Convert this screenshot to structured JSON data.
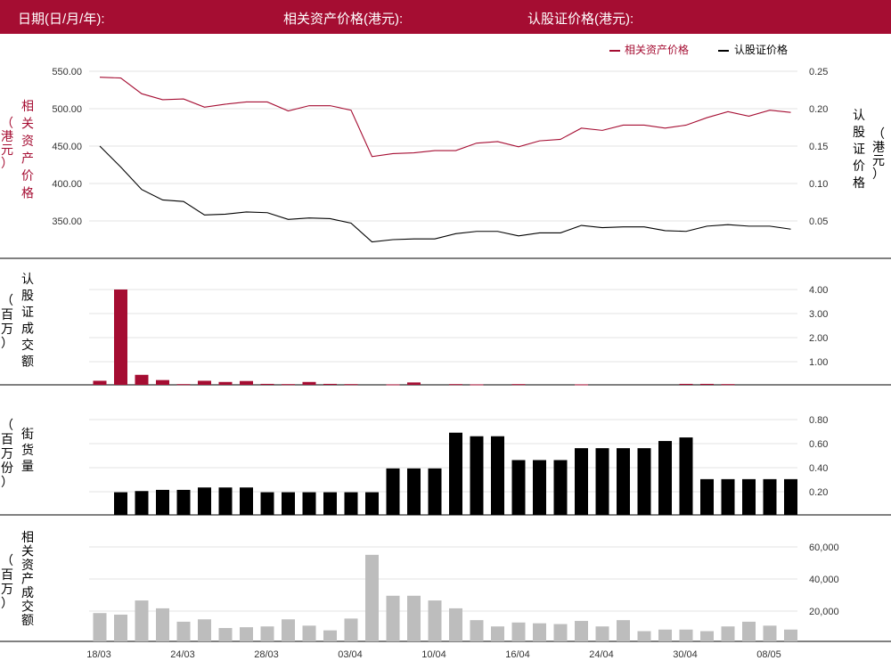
{
  "header": {
    "date_label": "日期(日/月/年):",
    "underlying_price_label": "相关资产价格(港元):",
    "warrant_price_label": "认股证价格(港元):"
  },
  "colors": {
    "brand": "#a50d32",
    "underlying": "#a50d32",
    "warrant": "#000000",
    "underlying_turnover": "#bdbdbd",
    "grid": "#e3e3e3"
  },
  "chart_data": [
    {
      "type": "line",
      "legend_placement": "top-right",
      "grid": true,
      "left_axis": {
        "label_chars": [
          "相",
          "关",
          "资",
          "产",
          "价",
          "格"
        ],
        "unit_chars": [
          "（",
          "港",
          "元",
          "）"
        ],
        "ticks": [
          "350.00",
          "400.00",
          "450.00",
          "500.00",
          "550.00"
        ],
        "ylim": [
          323,
          561
        ]
      },
      "right_axis": {
        "label_chars": [
          "认",
          "股",
          "证",
          "价",
          "格"
        ],
        "unit_chars": [
          "（",
          "港",
          "元",
          "）"
        ],
        "ticks": [
          "0.05",
          "0.10",
          "0.15",
          "0.20",
          "0.25"
        ],
        "ylim": [
          0.016,
          0.259
        ]
      },
      "series": [
        {
          "name": "相关资产价格",
          "axis": "left",
          "values": [
            542,
            541,
            520,
            512,
            513,
            502,
            506,
            509,
            509,
            497,
            504,
            504,
            498,
            436,
            440,
            441,
            444,
            444,
            454,
            456,
            449,
            457,
            459,
            474,
            471,
            478,
            478,
            474,
            478,
            488,
            496,
            490,
            498,
            495
          ]
        },
        {
          "name": "认股证价格",
          "axis": "right",
          "values": [
            0.15,
            0.122,
            0.092,
            0.078,
            0.076,
            0.058,
            0.059,
            0.062,
            0.061,
            0.052,
            0.054,
            0.053,
            0.047,
            0.022,
            0.025,
            0.026,
            0.026,
            0.033,
            0.036,
            0.036,
            0.03,
            0.034,
            0.034,
            0.044,
            0.041,
            0.042,
            0.042,
            0.037,
            0.036,
            0.043,
            0.045,
            0.043,
            0.043,
            0.039
          ]
        }
      ]
    },
    {
      "type": "bar",
      "axis_label_chars": [
        "认",
        "股",
        "证",
        "成",
        "交",
        "额"
      ],
      "axis_unit_chars": [
        "（",
        "百",
        "万",
        "）"
      ],
      "ticks": [
        "1.00",
        "2.00",
        "3.00",
        "4.00"
      ],
      "ylim": [
        0,
        4.4
      ],
      "values": [
        0.17,
        4.0,
        0.42,
        0.2,
        0.03,
        0.17,
        0.12,
        0.16,
        0.04,
        0.03,
        0.12,
        0.04,
        0.03,
        0,
        0.02,
        0.1,
        0,
        0.03,
        0.02,
        0,
        0.03,
        0,
        0,
        0.02,
        0,
        0,
        0,
        0,
        0.04,
        0.04,
        0.03,
        0,
        0,
        0
      ]
    },
    {
      "type": "bar",
      "axis_label_chars": [
        "街",
        "货",
        "量"
      ],
      "axis_unit_chars": [
        "（",
        "百",
        "万",
        "份",
        "）"
      ],
      "ticks": [
        "0.20",
        "0.40",
        "0.60",
        "0.80"
      ],
      "ylim": [
        0,
        0.86
      ],
      "values": [
        0,
        0.19,
        0.2,
        0.21,
        0.21,
        0.23,
        0.23,
        0.23,
        0.19,
        0.19,
        0.19,
        0.19,
        0.19,
        0.19,
        0.39,
        0.39,
        0.39,
        0.69,
        0.66,
        0.66,
        0.46,
        0.46,
        0.46,
        0.56,
        0.56,
        0.56,
        0.56,
        0.62,
        0.65,
        0.3,
        0.3,
        0.3,
        0.3,
        0.3
      ]
    },
    {
      "type": "bar",
      "axis_label_chars": [
        "相",
        "关",
        "资",
        "产",
        "成",
        "交",
        "额"
      ],
      "axis_unit_chars": [
        "（",
        "百",
        "万",
        "）"
      ],
      "ticks": [
        "20,000",
        "40,000",
        "60,000"
      ],
      "ylim": [
        0,
        64000
      ],
      "x_tick_labels": [
        "18/03",
        "24/03",
        "28/03",
        "03/04",
        "10/04",
        "16/04",
        "24/04",
        "30/04",
        "08/05"
      ],
      "values": [
        18000,
        17000,
        26000,
        21000,
        12500,
        14000,
        8500,
        9000,
        9500,
        14000,
        10000,
        7000,
        14500,
        55000,
        29000,
        29000,
        26000,
        21000,
        13500,
        9500,
        12000,
        11500,
        11000,
        13000,
        9500,
        13500,
        6500,
        7500,
        7500,
        6500,
        9500,
        12500,
        10000,
        7500
      ]
    }
  ]
}
